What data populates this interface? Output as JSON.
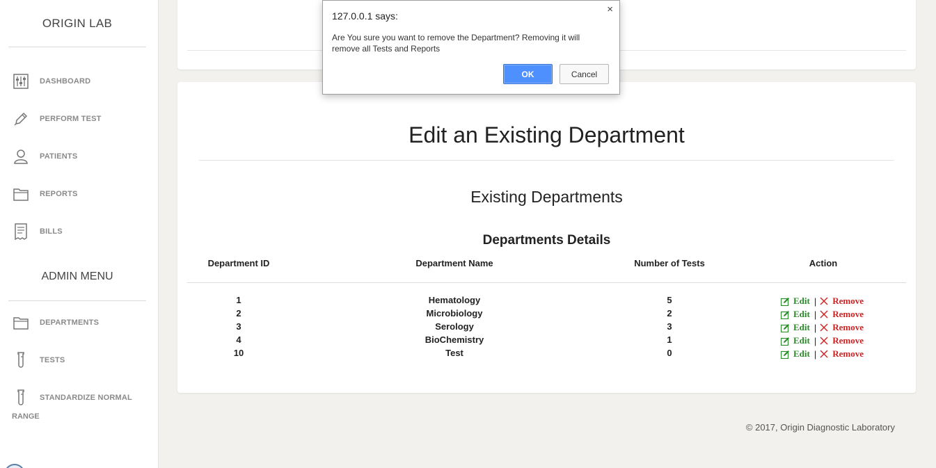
{
  "sidebar": {
    "logo": "ORIGIN LAB",
    "items": [
      {
        "label": "DASHBOARD",
        "icon": "sliders-icon"
      },
      {
        "label": "PERFORM TEST",
        "icon": "pen-icon"
      },
      {
        "label": "PATIENTS",
        "icon": "user-icon"
      },
      {
        "label": "REPORTS",
        "icon": "folder-icon"
      },
      {
        "label": "BILLS",
        "icon": "receipt-icon"
      }
    ],
    "admin_title": "ADMIN MENU",
    "admin_items": [
      {
        "label": "DEPARTMENTS",
        "icon": "folder-icon"
      },
      {
        "label": "TESTS",
        "icon": "test-tube-icon"
      },
      {
        "label": "STANDARDIZE NORMAL",
        "icon": "test-tube-icon"
      }
    ],
    "admin_item_continuation": "RANGE"
  },
  "main": {
    "title": "Edit an Existing Department",
    "subtitle": "Existing Departments",
    "table_caption": "Departments Details",
    "columns": [
      "Department ID",
      "Department Name",
      "Number of Tests",
      "Action"
    ],
    "rows": [
      {
        "id": "1",
        "name": "Hematology",
        "tests": "5"
      },
      {
        "id": "2",
        "name": "Microbiology",
        "tests": "2"
      },
      {
        "id": "3",
        "name": "Serology",
        "tests": "3"
      },
      {
        "id": "4",
        "name": "BioChemistry",
        "tests": "1"
      },
      {
        "id": "10",
        "name": "Test",
        "tests": "0"
      }
    ],
    "action_edit": "Edit",
    "action_separator": "|",
    "action_remove": "Remove"
  },
  "footer": "© 2017, Origin Diagnostic Laboratory",
  "dialog": {
    "title": "127.0.0.1 says:",
    "close": "×",
    "message": "Are You sure you want to remove the Department? Removing it will remove all Tests and Reports",
    "ok": "OK",
    "cancel": "Cancel"
  },
  "colors": {
    "edit": "#2a8a2a",
    "remove": "#cc2222",
    "ok_button": "#4d90fe",
    "background": "#f2f1ee"
  }
}
